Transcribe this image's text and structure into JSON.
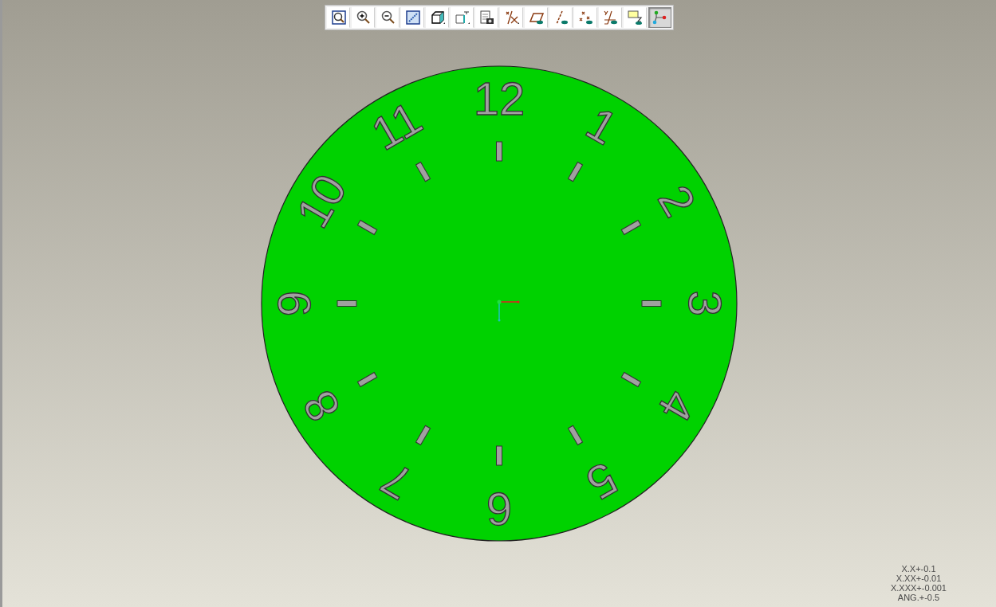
{
  "toolbar": {
    "buttons": [
      {
        "selected": false
      },
      {
        "selected": false
      },
      {
        "selected": false
      },
      {
        "selected": false
      },
      {
        "selected": false
      },
      {
        "selected": false
      },
      {
        "selected": false
      },
      {
        "selected": false
      },
      {
        "selected": false
      },
      {
        "selected": false
      },
      {
        "selected": false
      },
      {
        "selected": false
      },
      {
        "selected": false
      },
      {
        "selected": true
      }
    ]
  },
  "clock": {
    "numerals": [
      "12",
      "1",
      "2",
      "3",
      "4",
      "5",
      "6",
      "7",
      "8",
      "9",
      "10",
      "11"
    ]
  },
  "tolerances": [
    "X.X+-0.1",
    "X.XX+-0.01",
    "X.XXX+-0.001",
    "ANG.+-0.5"
  ]
}
